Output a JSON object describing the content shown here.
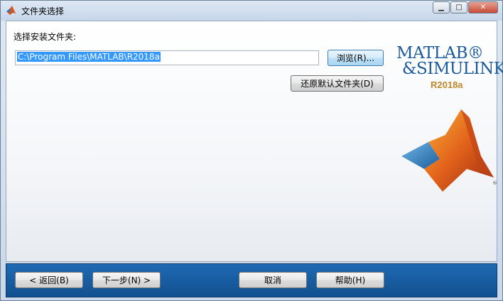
{
  "window": {
    "title": "文件夹选择",
    "controls": {
      "minimize": "▁",
      "maximize": "□",
      "close": "✕"
    }
  },
  "form": {
    "folder_label": "选择安装文件夹:",
    "path_value": "C:\\Program Files\\MATLAB\\R2018a",
    "browse_label": "浏览(R)...",
    "restore_label": "还原默认文件夹(D)"
  },
  "logo": {
    "line1": "MATLAB®",
    "line2": "&SIMULINK®",
    "version": "R2018a",
    "icon": "matlab-membrane-icon"
  },
  "footer": {
    "back_label": "< 返回(B)",
    "next_label": "下一步(N) >",
    "cancel_label": "取消",
    "help_label": "帮助(H)"
  },
  "colors": {
    "accent": "#1c5a99",
    "footer_bar": "#1a5fa3",
    "selection": "#3399ff"
  }
}
